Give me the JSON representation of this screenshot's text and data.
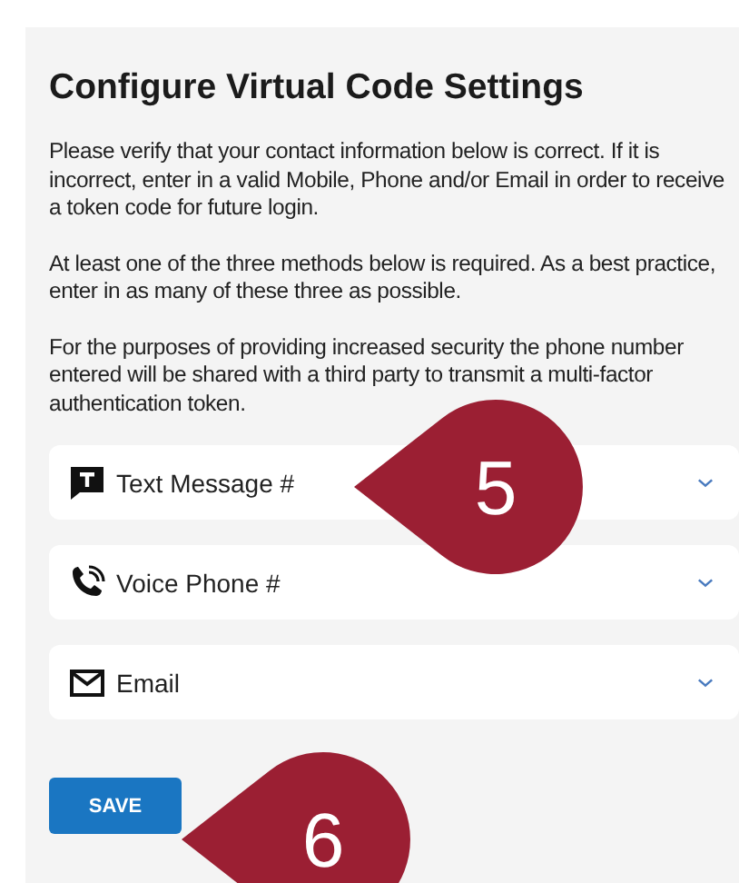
{
  "title": "Configure Virtual Code Settings",
  "paragraphs": [
    "Please verify that your contact information below is correct. If it is incorrect, enter in a valid Mobile, Phone and/or Email in order to receive a token code for future login.",
    "At least one of the three methods below is required. As a best practice, enter in as many of these three as possible.",
    "For the purposes of providing increased security the phone number entered will be shared with a third party to transmit a multi-factor authentication token."
  ],
  "methods": [
    {
      "kind": "sms",
      "label": "Text Message #",
      "expanded": false
    },
    {
      "kind": "phone",
      "label": "Voice Phone #",
      "expanded": false
    },
    {
      "kind": "email",
      "label": "Email",
      "expanded": false
    }
  ],
  "save_button": "SAVE",
  "callouts": [
    {
      "number": "5"
    },
    {
      "number": "6"
    }
  ]
}
